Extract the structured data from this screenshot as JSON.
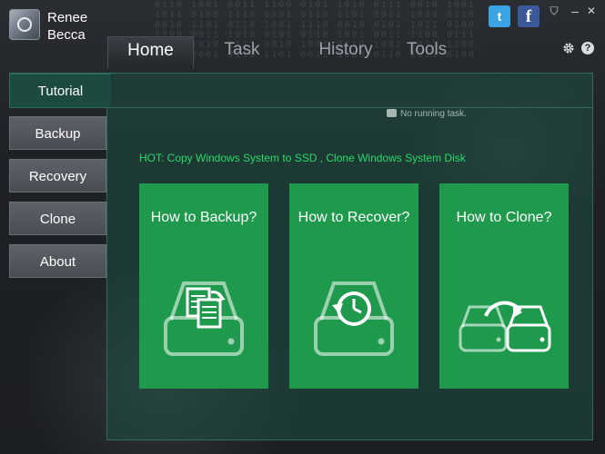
{
  "app": {
    "name_line1": "Renee",
    "name_line2": "Becca"
  },
  "tabs": [
    {
      "label": "Home",
      "active": true
    },
    {
      "label": "Task",
      "active": false
    },
    {
      "label": "History",
      "active": false
    },
    {
      "label": "Tools",
      "active": false
    }
  ],
  "titlebar": {
    "twitter_glyph": "t",
    "facebook_glyph": "f",
    "minimize_glyph": "–",
    "close_glyph": "✕",
    "skin_glyph": "⛉",
    "gear_glyph": "⚙",
    "help_glyph": "?"
  },
  "sidebar": {
    "items": [
      {
        "label": "Tutorial",
        "active": true
      },
      {
        "label": "Backup",
        "active": false
      },
      {
        "label": "Recovery",
        "active": false
      },
      {
        "label": "Clone",
        "active": false
      },
      {
        "label": "About",
        "active": false
      }
    ]
  },
  "main": {
    "status_text": "No running task.",
    "hot_text": "HOT: Copy Windows System to SSD , Clone Windows System Disk",
    "cards": [
      {
        "title": "How to Backup?",
        "icon": "backup-drive-icon"
      },
      {
        "title": "How to Recover?",
        "icon": "recover-drive-icon"
      },
      {
        "title": "How to Clone?",
        "icon": "clone-drives-icon"
      }
    ]
  },
  "colors": {
    "card_green": "#1f9a4d",
    "hot_green": "#2bd96a",
    "panel_teal": "#1c4a40"
  }
}
